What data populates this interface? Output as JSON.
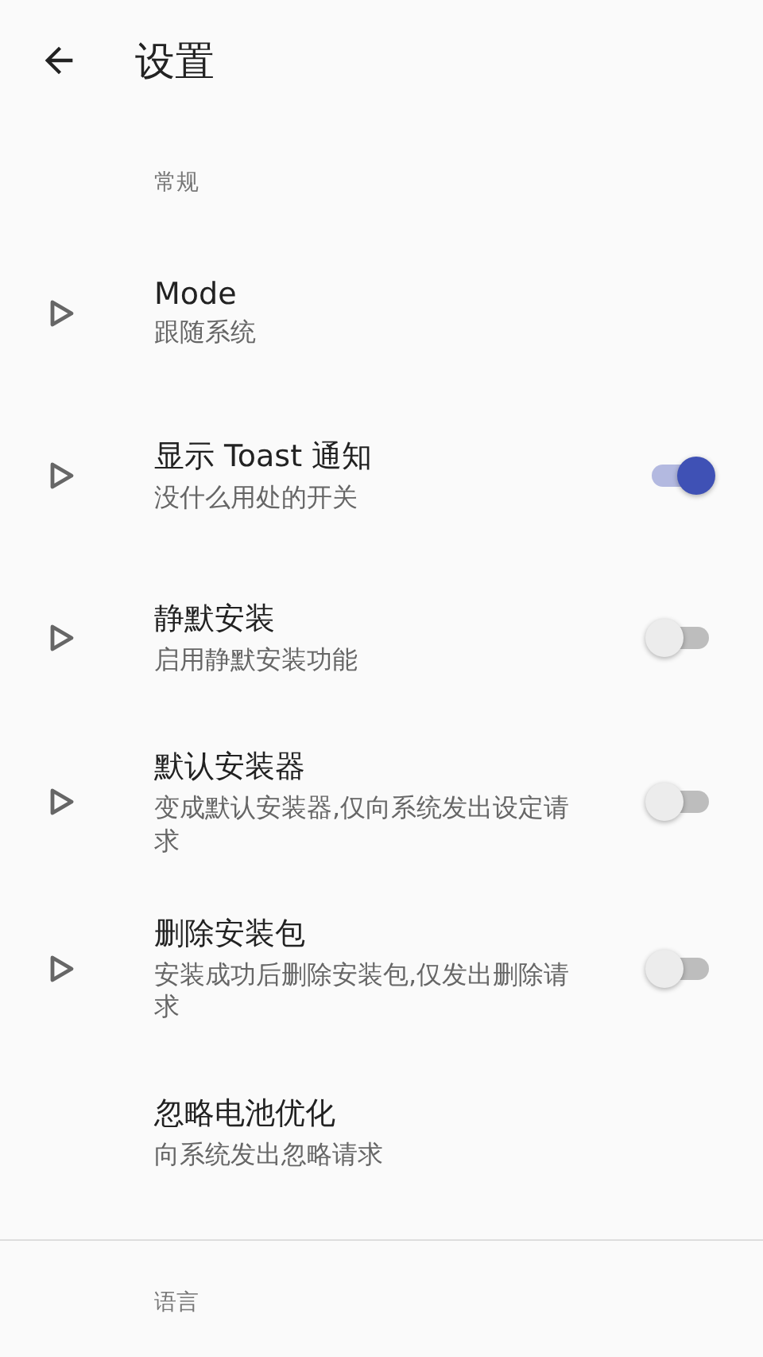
{
  "app_bar": {
    "title": "设置"
  },
  "sections": [
    {
      "label": "常规",
      "items": [
        {
          "kind": "text",
          "expandable": true,
          "title": "Mode",
          "summary": "跟随系统"
        },
        {
          "kind": "switch",
          "expandable": true,
          "title": "显示 Toast 通知",
          "summary": "没什么用处的开关",
          "on": true
        },
        {
          "kind": "switch",
          "expandable": true,
          "title": "静默安装",
          "summary": "启用静默安装功能",
          "on": false
        },
        {
          "kind": "switch",
          "expandable": true,
          "title": "默认安装器",
          "summary": "变成默认安装器,仅向系统发出设定请求",
          "on": false
        },
        {
          "kind": "switch",
          "expandable": true,
          "title": "删除安装包",
          "summary": "安装成功后删除安装包,仅发出删除请求",
          "on": false
        },
        {
          "kind": "text",
          "expandable": false,
          "title": "忽略电池优化",
          "summary": "向系统发出忽略请求"
        }
      ]
    },
    {
      "label": "语言"
    }
  ]
}
